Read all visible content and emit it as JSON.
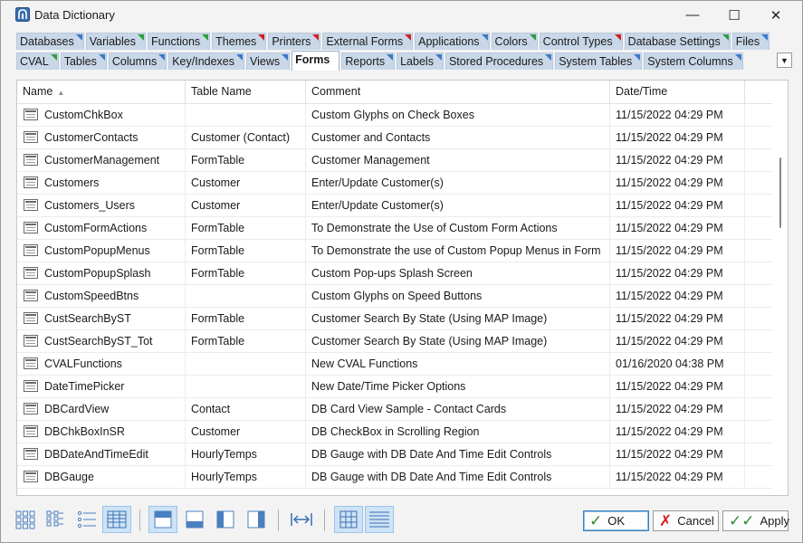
{
  "window": {
    "title": "Data Dictionary",
    "minimize": "—",
    "maximize": "☐",
    "close": "✕"
  },
  "tabs_row1": [
    {
      "label": "Databases",
      "flag": "#3c78c8"
    },
    {
      "label": "Variables",
      "flag": "#2e9e3e"
    },
    {
      "label": "Functions",
      "flag": "#2e9e3e"
    },
    {
      "label": "Themes",
      "flag": "#d02020"
    },
    {
      "label": "Printers",
      "flag": "#d02020"
    },
    {
      "label": "External Forms",
      "flag": "#d02020"
    },
    {
      "label": "Applications",
      "flag": "#3c78c8"
    },
    {
      "label": "Colors",
      "flag": "#2e9e3e"
    },
    {
      "label": "Control Types",
      "flag": "#d02020"
    },
    {
      "label": "Database Settings",
      "flag": "#2e9e3e"
    },
    {
      "label": "Files",
      "flag": "#3c78c8"
    }
  ],
  "tabs_row2": [
    {
      "label": "CVAL",
      "flag": "#2e9e3e"
    },
    {
      "label": "Tables",
      "flag": "#3c78c8"
    },
    {
      "label": "Columns",
      "flag": "#3c78c8"
    },
    {
      "label": "Key/Indexes",
      "flag": "#3c78c8"
    },
    {
      "label": "Views",
      "flag": "#3c78c8"
    },
    {
      "label": "Forms",
      "flag": "#3c78c8",
      "active": true
    },
    {
      "label": "Reports",
      "flag": "#3c78c8"
    },
    {
      "label": "Labels",
      "flag": "#3c78c8"
    },
    {
      "label": "Stored Procedures",
      "flag": "#3c78c8"
    },
    {
      "label": "System Tables",
      "flag": "#3c78c8"
    },
    {
      "label": "System Columns",
      "flag": "#3c78c8"
    }
  ],
  "table": {
    "headers": [
      "Name",
      "Table Name",
      "Comment",
      "Date/Time"
    ],
    "rows": [
      [
        "CustomChkBox",
        "",
        "Custom Glyphs on Check Boxes",
        "11/15/2022 04:29 PM"
      ],
      [
        "CustomerContacts",
        "Customer (Contact)",
        "Customer and Contacts",
        "11/15/2022 04:29 PM"
      ],
      [
        "CustomerManagement",
        "FormTable",
        "Customer Management",
        "11/15/2022 04:29 PM"
      ],
      [
        "Customers",
        "Customer",
        "Enter/Update Customer(s)",
        "11/15/2022 04:29 PM"
      ],
      [
        "Customers_Users",
        "Customer",
        "Enter/Update Customer(s)",
        "11/15/2022 04:29 PM"
      ],
      [
        "CustomFormActions",
        "FormTable",
        "To Demonstrate the Use of Custom Form Actions",
        "11/15/2022 04:29 PM"
      ],
      [
        "CustomPopupMenus",
        "FormTable",
        "To Demonstrate the use of Custom Popup Menus in Form",
        "11/15/2022 04:29 PM"
      ],
      [
        "CustomPopupSplash",
        "FormTable",
        "Custom Pop-ups Splash Screen",
        "11/15/2022 04:29 PM"
      ],
      [
        "CustomSpeedBtns",
        "",
        "Custom Glyphs on Speed Buttons",
        "11/15/2022 04:29 PM"
      ],
      [
        "CustSearchByST",
        "FormTable",
        "Customer Search By State (Using MAP Image)",
        "11/15/2022 04:29 PM"
      ],
      [
        "CustSearchByST_Tot",
        "FormTable",
        "Customer Search By State (Using MAP Image)",
        "11/15/2022 04:29 PM"
      ],
      [
        "CVALFunctions",
        "",
        "New CVAL Functions",
        "01/16/2020 04:38 PM"
      ],
      [
        "DateTimePicker",
        "",
        "New Date/Time Picker Options",
        "11/15/2022 04:29 PM"
      ],
      [
        "DBCardView",
        "Contact",
        "DB Card View Sample - Contact Cards",
        "11/15/2022 04:29 PM"
      ],
      [
        "DBChkBoxInSR",
        "Customer",
        "DB CheckBox in Scrolling Region",
        "11/15/2022 04:29 PM"
      ],
      [
        "DBDateAndTimeEdit",
        "HourlyTemps",
        "DB Gauge with DB Date And Time Edit Controls",
        "11/15/2022 04:29 PM"
      ],
      [
        "DBGauge",
        "HourlyTemps",
        "DB Gauge with DB Date And Time Edit Controls",
        "11/15/2022 04:29 PM"
      ]
    ]
  },
  "buttons": {
    "ok": "OK",
    "cancel": "Cancel",
    "apply": "Apply"
  },
  "colors": {
    "ok_check": "#2e8b2e",
    "cancel_x": "#d42020",
    "apply_check": "#2e8b2e",
    "accent": "#3c78c8"
  }
}
